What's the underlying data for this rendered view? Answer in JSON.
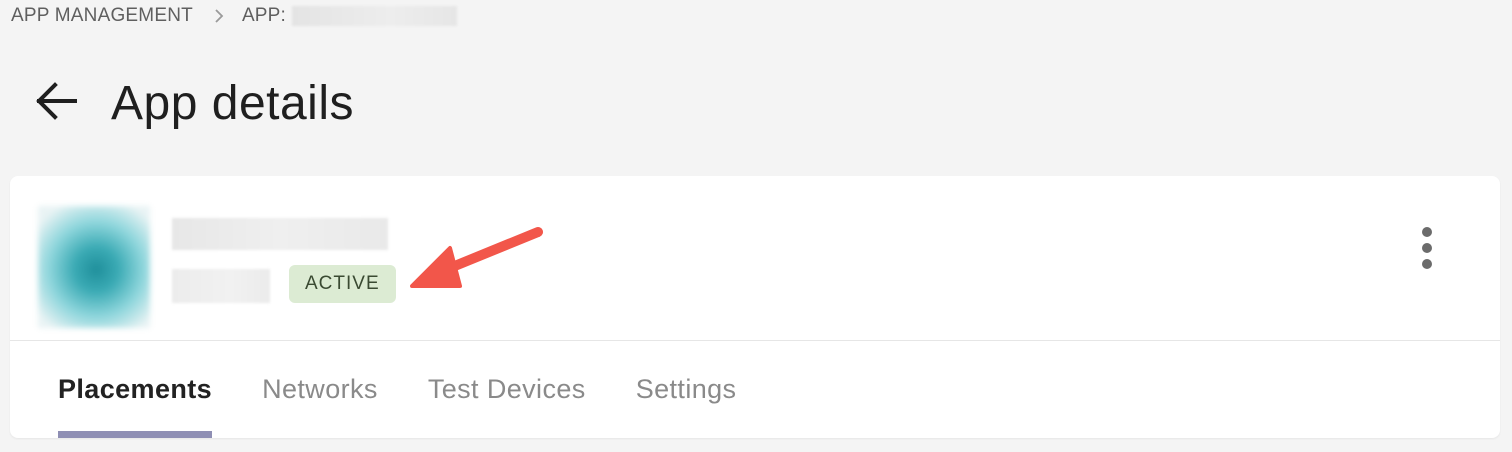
{
  "breadcrumb": {
    "root": "APP MANAGEMENT",
    "current_prefix": "APP:"
  },
  "header": {
    "title": "App details",
    "back_icon": "arrow-left-icon"
  },
  "app_card": {
    "status": "ACTIVE",
    "status_color": "#dcebd3",
    "annotation_color": "#f2564a",
    "more_icon": "vertical-ellipsis-icon"
  },
  "tabs": [
    {
      "label": "Placements",
      "active": true
    },
    {
      "label": "Networks",
      "active": false
    },
    {
      "label": "Test Devices",
      "active": false
    },
    {
      "label": "Settings",
      "active": false
    }
  ],
  "colors": {
    "tab_indicator": "#8f8fb4",
    "background": "#f4f4f4"
  }
}
